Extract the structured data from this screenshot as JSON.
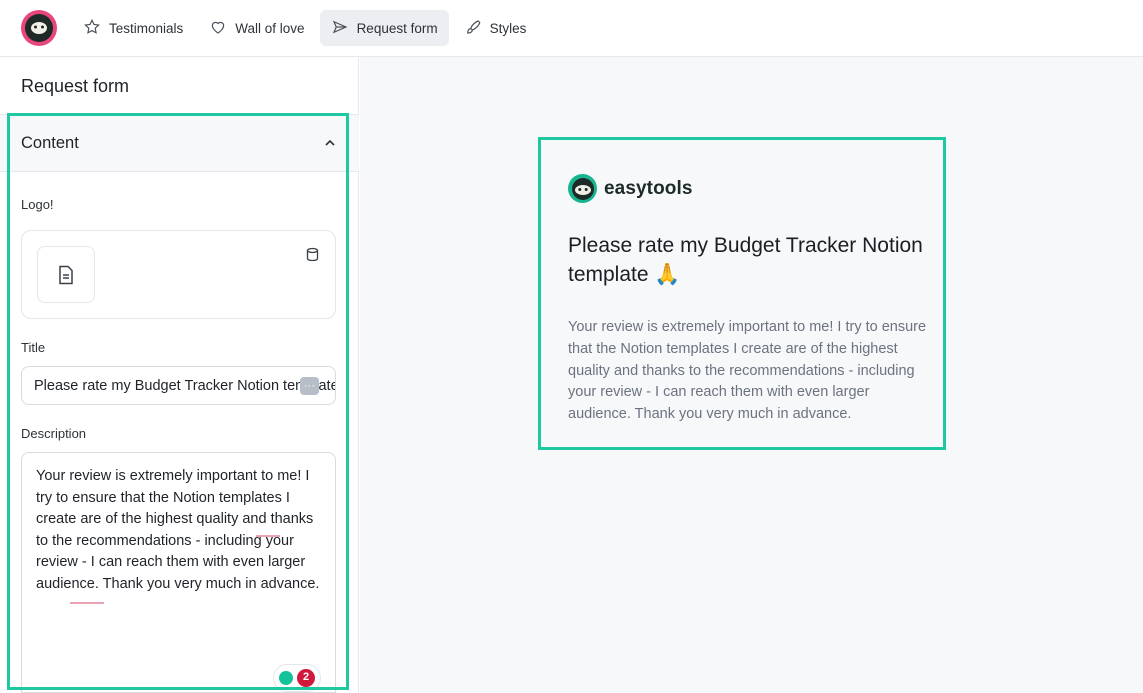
{
  "nav": {
    "items": [
      {
        "label": "Testimonials",
        "icon": "star-icon"
      },
      {
        "label": "Wall of love",
        "icon": "heart-icon"
      },
      {
        "label": "Request form",
        "icon": "send-icon"
      },
      {
        "label": "Styles",
        "icon": "brush-icon"
      }
    ],
    "active": "Request form"
  },
  "left": {
    "panel_title": "Request form",
    "section_label": "Content",
    "logo_label": "Logo!",
    "title_label": "Title",
    "title_value": "Please rate my Budget Tracker Notion template",
    "description_label": "Description",
    "description_value": "Your review is extremely important to me! I try to ensure that the Notion templates I create are of the highest quality and thanks to the recommendations - including your review - I can reach them with even larger audience. Thank you very much in advance.",
    "grammarly_count": "2",
    "dots_badge": "···"
  },
  "preview": {
    "brand_name": "easytools",
    "title": "Please rate my Budget Tracker Notion template 🙏",
    "description": "Your review is extremely important to me! I try to ensure that the Notion templates I create are of the highest quality and thanks to the recommendations - including your review - I can reach them with even larger audience. Thank you very much in advance."
  },
  "colors": {
    "highlight": "#1ec8a0",
    "brand_pink": "#e8467c",
    "brand_green": "#16b58f"
  }
}
